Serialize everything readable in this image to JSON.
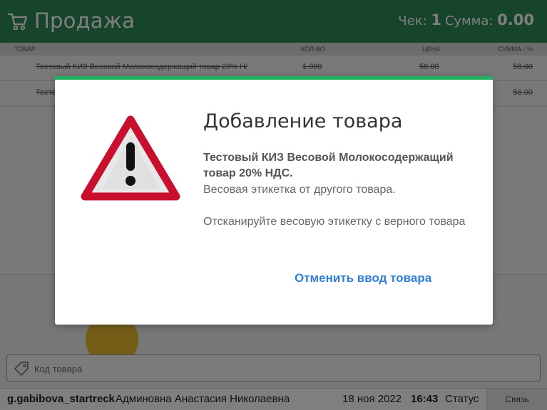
{
  "header": {
    "title": "Продажа",
    "check_label": "Чек:",
    "check_number": "1",
    "sum_label": "Сумма:",
    "sum_value": "0.00",
    "background_color": "#2e8b57",
    "cart_icon": "cart-icon"
  },
  "table": {
    "columns": [
      "ТОВАР",
      "КОЛ-ВО",
      "ЦЕНА",
      "СУММА - %"
    ],
    "rows": [
      {
        "name": "Тестовый КИЗ Весовой Молокосодержащий товар 20% Н/",
        "qty": "1.000",
        "price": "58.00",
        "sum": "58.00"
      },
      {
        "name": "Тесто",
        "qty": "",
        "price": "",
        "sum": "58.00"
      }
    ]
  },
  "barcode": {
    "placeholder": "Код товара",
    "icon": "tag-icon"
  },
  "statusbar": {
    "login": "g.gabibova_startreck",
    "fio": "Админовна Анастасия Николаевна",
    "date": "18 ноя 2022",
    "time": "16:43",
    "status": "Статус",
    "link_button": "Связь"
  },
  "modal": {
    "title": "Добавление товара",
    "product": "Тестовый КИЗ Весовой Молокосодержащий товар 20% НДС.",
    "reason": "Весовая этикетка от другого товара.",
    "hint": "Отсканируйте весовую этикетку с верного товара",
    "cancel_label": "Отменить ввод товара",
    "accent_color": "#20b060",
    "link_color": "#2d7fd8",
    "warning_color": "#c8102e",
    "icon": "warning-icon"
  }
}
